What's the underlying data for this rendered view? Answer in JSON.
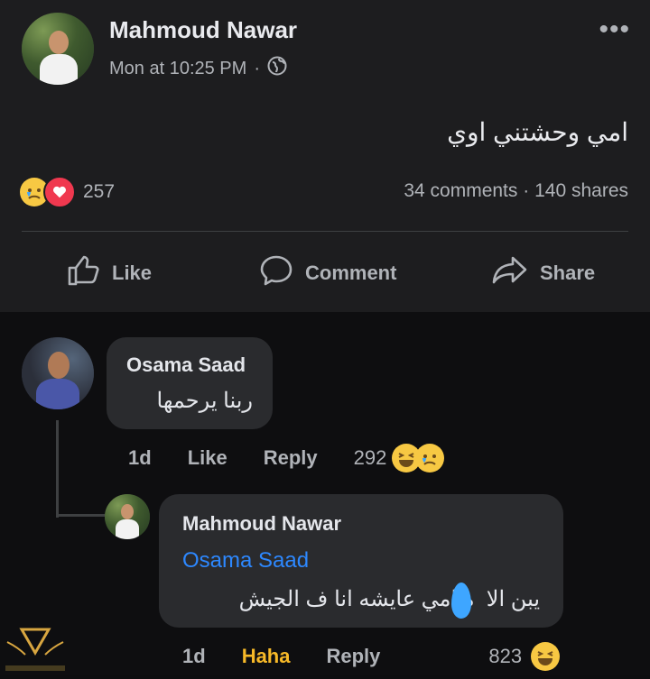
{
  "post": {
    "author": "Mahmoud Nawar",
    "time": "Mon at 10:25 PM",
    "separator": "·",
    "audience_icon": "globe-icon",
    "text": "امي وحشتني اوي",
    "more_icon": "•••",
    "reactions": [
      "sad-reaction-icon",
      "love-reaction-icon"
    ],
    "reaction_count": "257",
    "comments": "34 comments",
    "shares": "140 shares",
    "stats_separator": "·",
    "actions": {
      "like": "Like",
      "comment": "Comment",
      "share": "Share"
    }
  },
  "comments": [
    {
      "author": "Osama Saad",
      "text": "ربنا يرحمها",
      "time": "1d",
      "like": "Like",
      "reply": "Reply",
      "reaction_count": "292",
      "reactions": [
        "haha-reaction-icon",
        "sad-reaction-icon"
      ]
    },
    {
      "author": "Mahmoud Nawar",
      "mention": "Osama Saad",
      "text": "يبن الا  ه امي عايشه انا ف الجيش",
      "time": "1d",
      "like": "Haha",
      "reply": "Reply",
      "reaction_count": "823",
      "reactions": [
        "haha-reaction-icon"
      ]
    }
  ],
  "colors": {
    "page_bg": "#0d0d0f",
    "post_bg": "#1d1d1f",
    "bubble": "#2a2b2e",
    "mention": "#2d88ff",
    "haha_gold": "#f7b928"
  }
}
